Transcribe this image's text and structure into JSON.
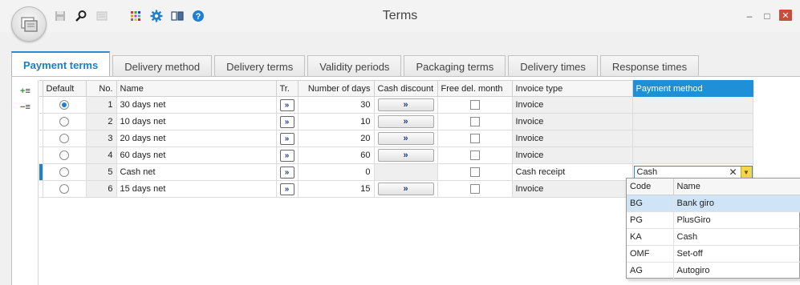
{
  "window": {
    "title": "Terms",
    "minimize_label": "–",
    "maximize_label": "□",
    "close_label": "✕"
  },
  "tabs": [
    {
      "label": "Payment terms",
      "active": true
    },
    {
      "label": "Delivery method"
    },
    {
      "label": "Delivery terms"
    },
    {
      "label": "Validity periods"
    },
    {
      "label": "Packaging terms"
    },
    {
      "label": "Delivery times"
    },
    {
      "label": "Response times"
    }
  ],
  "sidebar": {
    "add_label": "+≡",
    "remove_label": "−≡"
  },
  "grid": {
    "columns": {
      "default": "Default",
      "no": "No.",
      "name": "Name",
      "tr": "Tr.",
      "days": "Number of days",
      "cash_discount": "Cash discount",
      "free_del_month": "Free del. month",
      "invoice_type": "Invoice type",
      "payment_method": "Payment method"
    },
    "button_glyph": "»",
    "rows": [
      {
        "default": true,
        "no": "1",
        "name": "30 days net",
        "days": "30",
        "has_cd": true,
        "invoice_type": "Invoice",
        "payment_method": ""
      },
      {
        "default": false,
        "no": "2",
        "name": "10 days net",
        "days": "10",
        "has_cd": true,
        "invoice_type": "Invoice",
        "payment_method": ""
      },
      {
        "default": false,
        "no": "3",
        "name": "20 days net",
        "days": "20",
        "has_cd": true,
        "invoice_type": "Invoice",
        "payment_method": ""
      },
      {
        "default": false,
        "no": "4",
        "name": "60 days net",
        "days": "60",
        "has_cd": true,
        "invoice_type": "Invoice",
        "payment_method": ""
      },
      {
        "default": false,
        "no": "5",
        "name": "Cash net",
        "days": "0",
        "has_cd": false,
        "invoice_type": "Cash receipt",
        "payment_method": "Cash"
      },
      {
        "default": false,
        "no": "6",
        "name": "15 days net",
        "days": "15",
        "has_cd": true,
        "invoice_type": "Invoice",
        "payment_method": ""
      }
    ]
  },
  "popup": {
    "headers": {
      "code": "Code",
      "name": "Name"
    },
    "clear_glyph": "✕",
    "drop_glyph": "▼",
    "items": [
      {
        "code": "BG",
        "name": "Bank giro",
        "selected": true
      },
      {
        "code": "PG",
        "name": "PlusGiro"
      },
      {
        "code": "KA",
        "name": "Cash"
      },
      {
        "code": "OMF",
        "name": "Set-off"
      },
      {
        "code": "AG",
        "name": "Autogiro"
      }
    ]
  },
  "colors": {
    "accent": "#1f8fd8",
    "selected_row": "#cfe5f7",
    "close_button": "#c94c3d",
    "dropdown_arrow": "#f5d54a"
  },
  "icons": [
    "app-orb-icon",
    "save-icon",
    "search-icon",
    "document-icon",
    "color-grid-icon",
    "gear-icon",
    "book-icon",
    "help-icon"
  ]
}
